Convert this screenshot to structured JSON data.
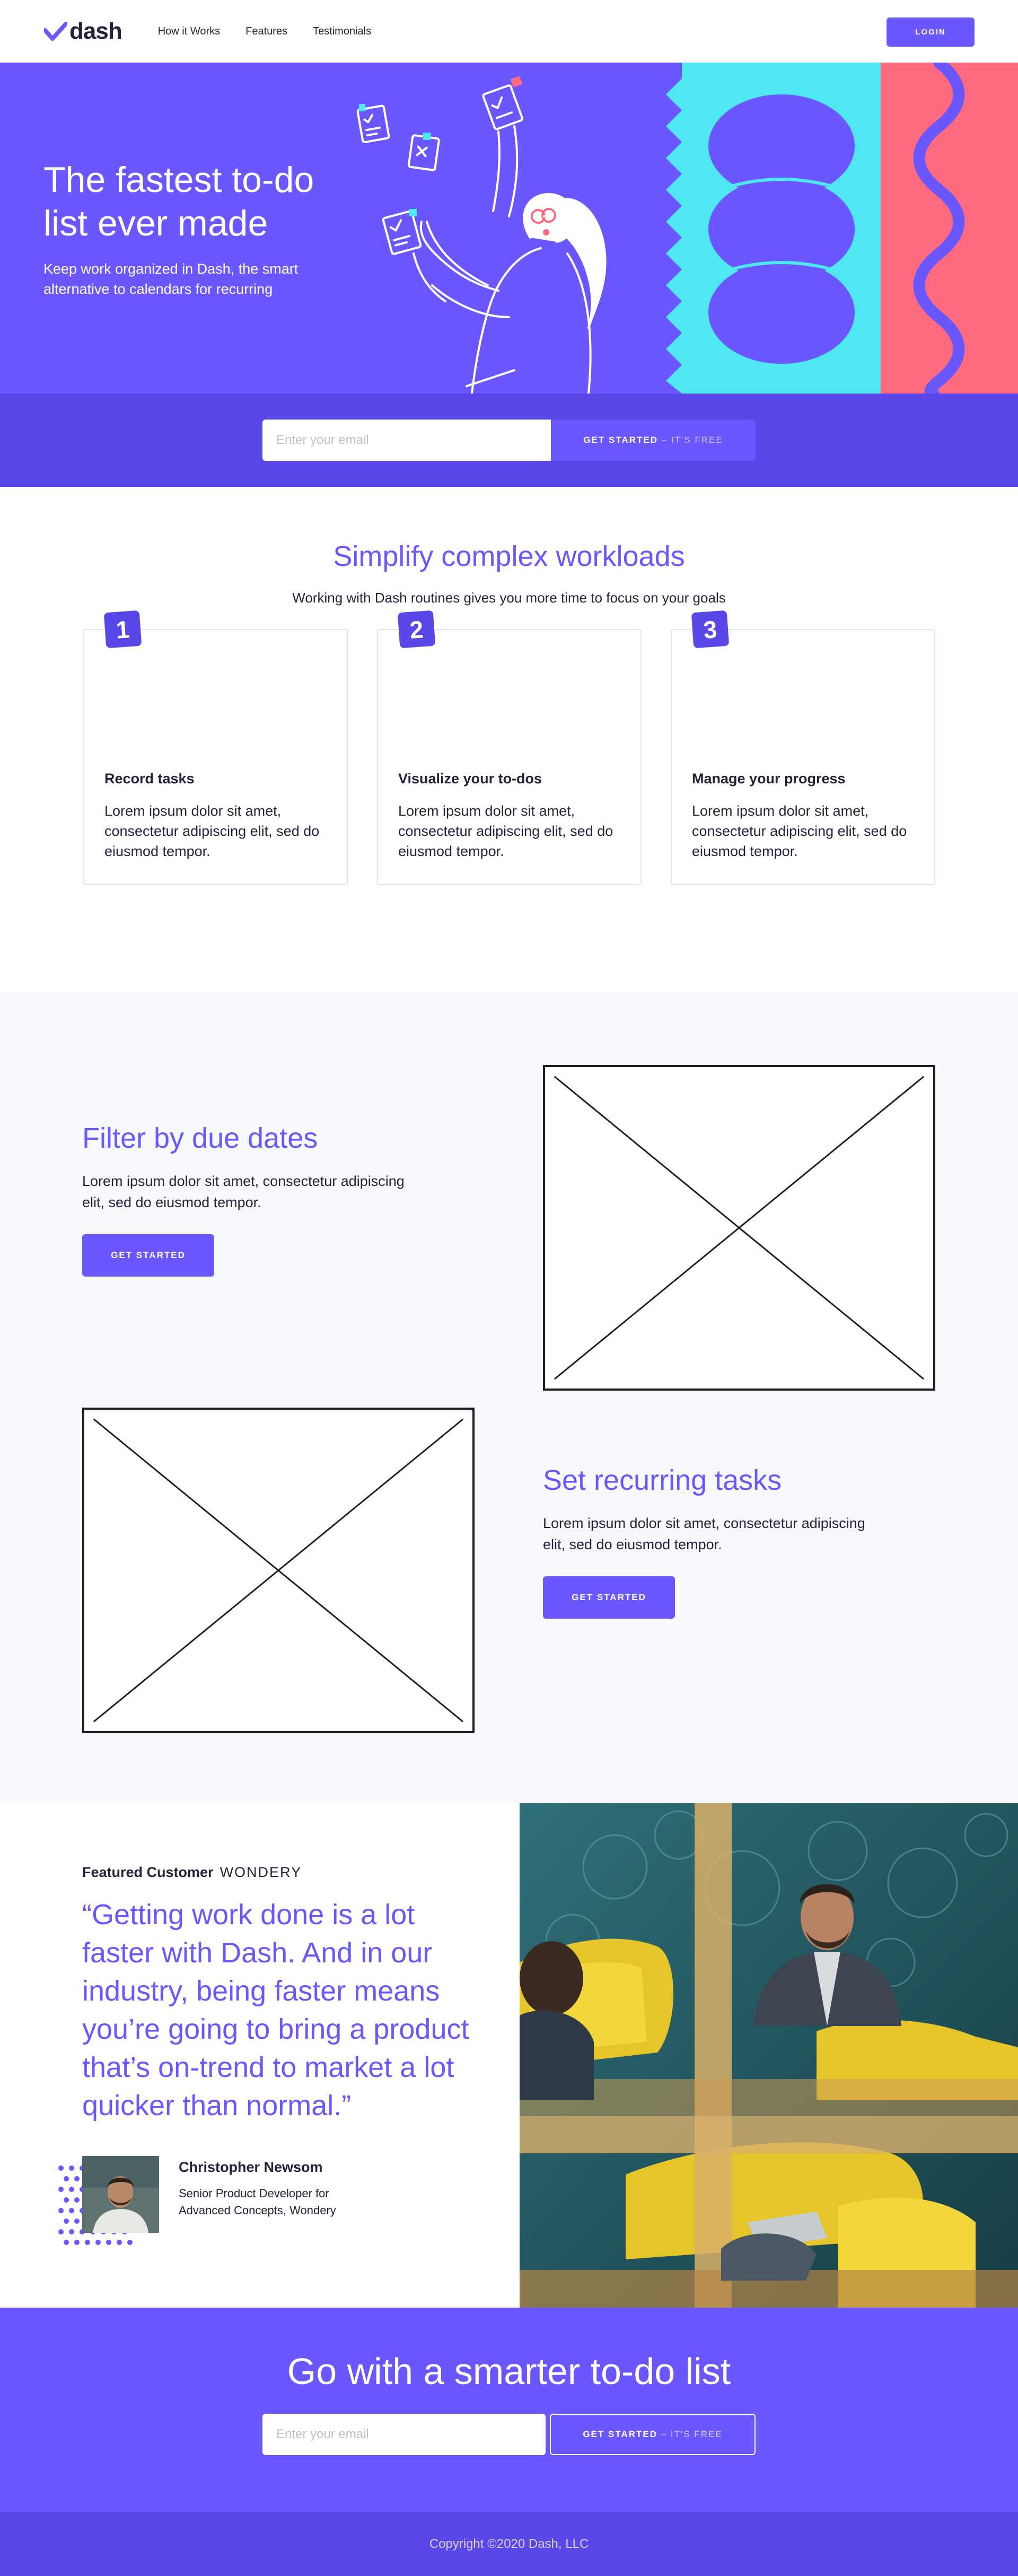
{
  "nav": {
    "logo": "dash",
    "links": [
      "How it Works",
      "Features",
      "Testimonials"
    ],
    "login": "LOGIN"
  },
  "hero": {
    "title_line1": "The fastest to-do",
    "title_line2": "list ever made",
    "subtitle_line1": "Keep work organized in Dash, the smart",
    "subtitle_line2": "alternative to calendars for recurring"
  },
  "signup": {
    "placeholder": "Enter your email",
    "button": "GET STARTED",
    "button_suffix": " – IT'S FREE"
  },
  "simplify": {
    "title": "Simplify complex workloads",
    "subtitle": "Working with Dash routines gives you more time to focus on your goals",
    "cards": [
      {
        "number": "1",
        "title": "Record tasks",
        "desc": "Lorem ipsum dolor sit amet, consectetur adipiscing elit, sed do eiusmod tempor."
      },
      {
        "number": "2",
        "title": "Visualize your to-dos",
        "desc": "Lorem ipsum dolor sit amet, consectetur adipiscing elit, sed do eiusmod tempor."
      },
      {
        "number": "3",
        "title": "Manage your progress",
        "desc": "Lorem ipsum dolor sit amet, consectetur adipiscing elit, sed do eiusmod tempor."
      }
    ]
  },
  "features": [
    {
      "title": "Filter by due dates",
      "desc": "Lorem ipsum dolor sit amet, consectetur adipiscing elit, sed do eiusmod tempor.",
      "button": "GET STARTED"
    },
    {
      "title": "Set recurring tasks",
      "desc": "Lorem ipsum dolor sit amet, consectetur adipiscing elit, sed do eiusmod tempor.",
      "button": "GET STARTED"
    }
  ],
  "testimonial": {
    "featured_label": "Featured Customer",
    "company": "WONDERY",
    "quote": "“Getting work done is a lot faster with Dash. And in our industry, being faster means you’re going to bring a product that’s on-trend to market a lot quicker than normal.”",
    "author_name": "Christopher Newsom",
    "author_role": "Senior Product Developer for Advanced Concepts, Wondery"
  },
  "cta": {
    "title": "Go with a smarter to-do list",
    "placeholder": "Enter your email",
    "button": "GET STARTED",
    "button_suffix": " – IT'S FREE"
  },
  "footer": {
    "copyright": "Copyright ©2020 Dash, LLC"
  },
  "colors": {
    "brand_purple": "#6a57ff",
    "deep_purple": "#5947e8",
    "cyan": "#4fe7f2",
    "pink": "#ff6a7f",
    "text_dark": "#25233a"
  }
}
